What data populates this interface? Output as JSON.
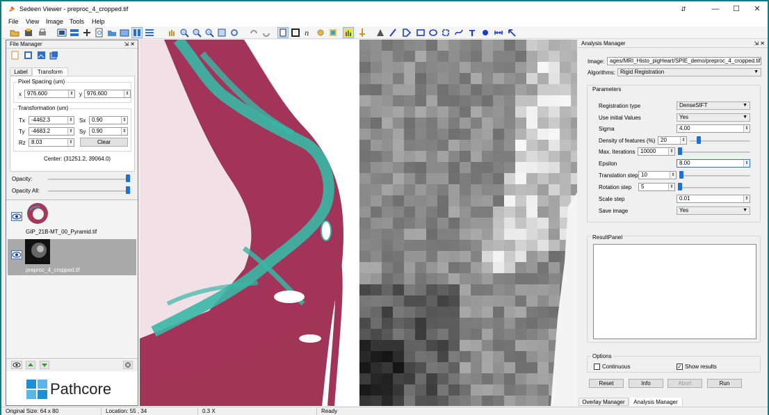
{
  "window": {
    "title": "Sedeen Viewer - preproc_4_cropped.tif",
    "restore_glyph": "⇵",
    "minimize_glyph": "—",
    "maximize_glyph": "☐",
    "close_glyph": "✕"
  },
  "menu": [
    "File",
    "View",
    "Image",
    "Tools",
    "Help"
  ],
  "file_manager": {
    "title": "File Manager",
    "float_glyph": "⇲ ✕",
    "tabs": [
      "Label",
      "Transform"
    ],
    "active_tab": "Transform",
    "pixel_spacing": {
      "title": "Pixel Spacing (um)",
      "x_label": "x",
      "x_value": "976.600",
      "y_label": "y",
      "y_value": "976.600"
    },
    "transformation": {
      "title": "Transformation (um)",
      "tx_label": "Tx",
      "tx_value": "-4462.3",
      "sx_label": "Sx",
      "sx_value": "0.90",
      "ty_label": "Ty",
      "ty_value": "-4683.2",
      "sy_label": "Sy",
      "sy_value": "0.90",
      "rz_label": "Rz",
      "rz_value": "8.03",
      "clear_label": "Clear"
    },
    "center_text": "Center: (31251.2, 39064.0)",
    "opacity_label": "Opacity:",
    "opacity_all_label": "Opacity All:",
    "opacity_value": 1.0,
    "opacity_all_value": 1.0,
    "files": [
      {
        "name": "GIP_21B-MT_00_Pyramid.tif",
        "selected": false
      },
      {
        "name": "preproc_4_cropped.tif",
        "selected": true
      }
    ],
    "logo_text": "Pathcore"
  },
  "analysis_manager": {
    "title": "Analysis Manager",
    "float_glyph": "⇲ ✕",
    "image_label": "Image:",
    "image_value": "ages/MRI_Histo_pigHeart/SPIE_demo/preproc_4_cropped.tif",
    "algorithm_label": "Algorithms:",
    "algorithm_value": "Rigid Registration",
    "parameters_title": "Parameters",
    "params": [
      {
        "label": "Registration type",
        "value": "DenseSIFT",
        "kind": "combo"
      },
      {
        "label": "Use initial Values",
        "value": "Yes",
        "kind": "combo"
      },
      {
        "label": "Sigma",
        "value": "4.00",
        "kind": "spin"
      },
      {
        "label": "Density of features (%)",
        "value": "20",
        "kind": "slider",
        "level": 0.12
      },
      {
        "label": "Max. Iterations",
        "value": "10000",
        "kind": "slider",
        "level": 0.0
      },
      {
        "label": "Epsilon",
        "value": "8.00",
        "kind": "spin"
      },
      {
        "label": "Translation step",
        "value": "10",
        "kind": "slider",
        "level": 0.0
      },
      {
        "label": "Rotation step",
        "value": "5",
        "kind": "slider",
        "level": 0.0
      },
      {
        "label": "Scale step",
        "value": "0.01",
        "kind": "spin"
      },
      {
        "label": "Save image",
        "value": "Yes",
        "kind": "combo"
      }
    ],
    "result_panel_title": "ResultPanel",
    "options_title": "Options",
    "continuous_label": "Continuous",
    "continuous_checked": false,
    "show_results_label": "Show results",
    "show_results_checked": true,
    "buttons": [
      "Reset",
      "Info",
      "Abort",
      "Run"
    ],
    "bottom_tabs": [
      "Overlay Manager",
      "Analysis Manager"
    ]
  },
  "status": {
    "original_size": "Original Size: 64 x 80",
    "location": "Location: 55 , 34",
    "zoom": "0.3 X",
    "state": "Ready"
  },
  "colors": {
    "frame": "#127a7a",
    "accent": "#1e6fd9",
    "logo_blue": "#1a8fd8",
    "tissue_red": "#9c2a4e",
    "tissue_teal": "#38b7a6"
  }
}
